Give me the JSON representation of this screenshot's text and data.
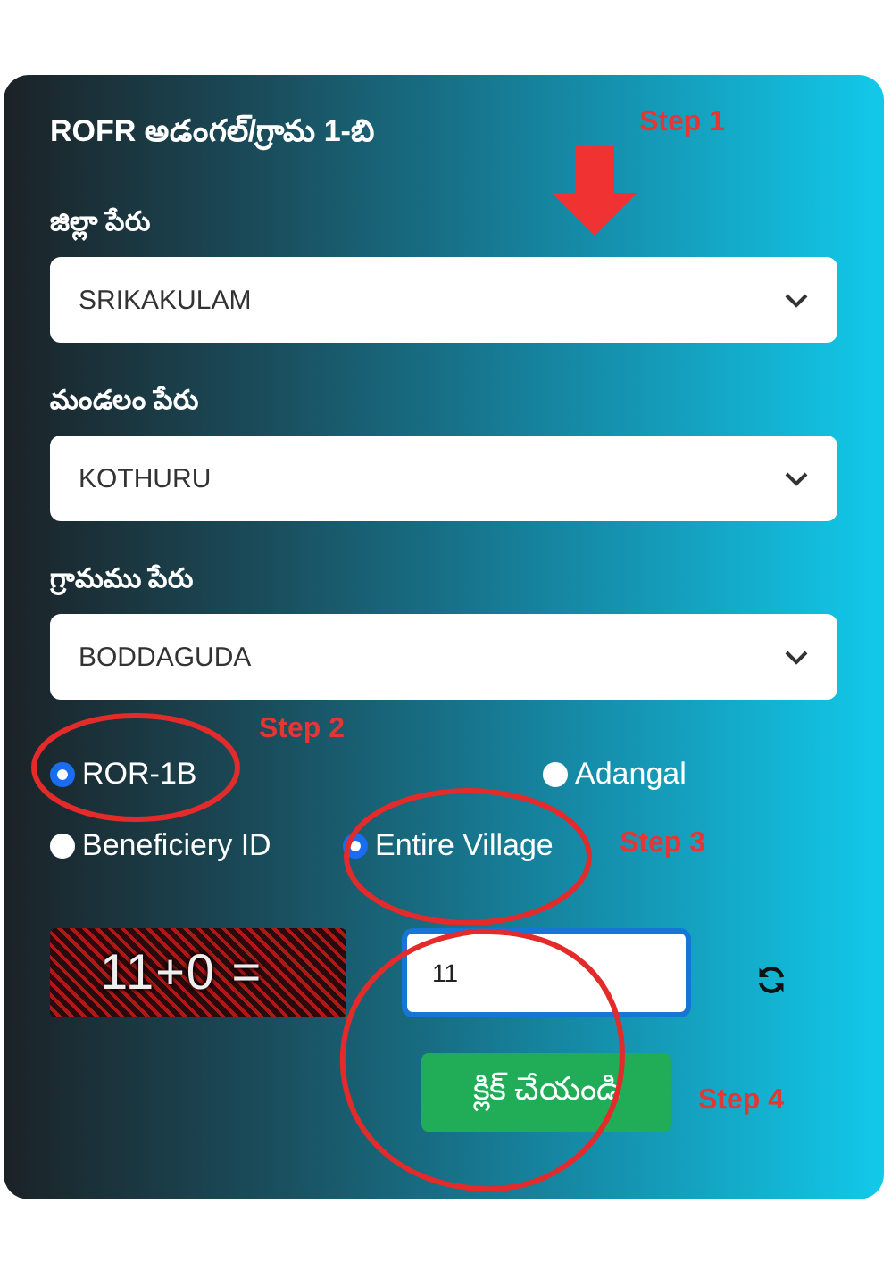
{
  "form": {
    "title": "ROFR అడంగల్/గ్రామ 1-బి",
    "fields": [
      {
        "label": "జిల్లా పేరు",
        "value": "SRIKAKULAM"
      },
      {
        "label": "మండలం పేరు",
        "value": "KOTHURU"
      },
      {
        "label": "గ్రామము పేరు",
        "value": "BODDAGUDA"
      }
    ],
    "report_type": [
      {
        "label": "ROR-1B",
        "selected": true
      },
      {
        "label": "Adangal",
        "selected": false
      }
    ],
    "search_by": [
      {
        "label": "Beneficiery ID",
        "selected": false
      },
      {
        "label": "Entire Village",
        "selected": true
      }
    ],
    "captcha": {
      "text": "11+0 =",
      "answer": "11"
    },
    "submit": "క్లిక్ చేయండి"
  },
  "annotations": [
    {
      "text": "Step 1"
    },
    {
      "text": "Step 2"
    },
    {
      "text": "Step 3"
    },
    {
      "text": "Step 4"
    }
  ]
}
